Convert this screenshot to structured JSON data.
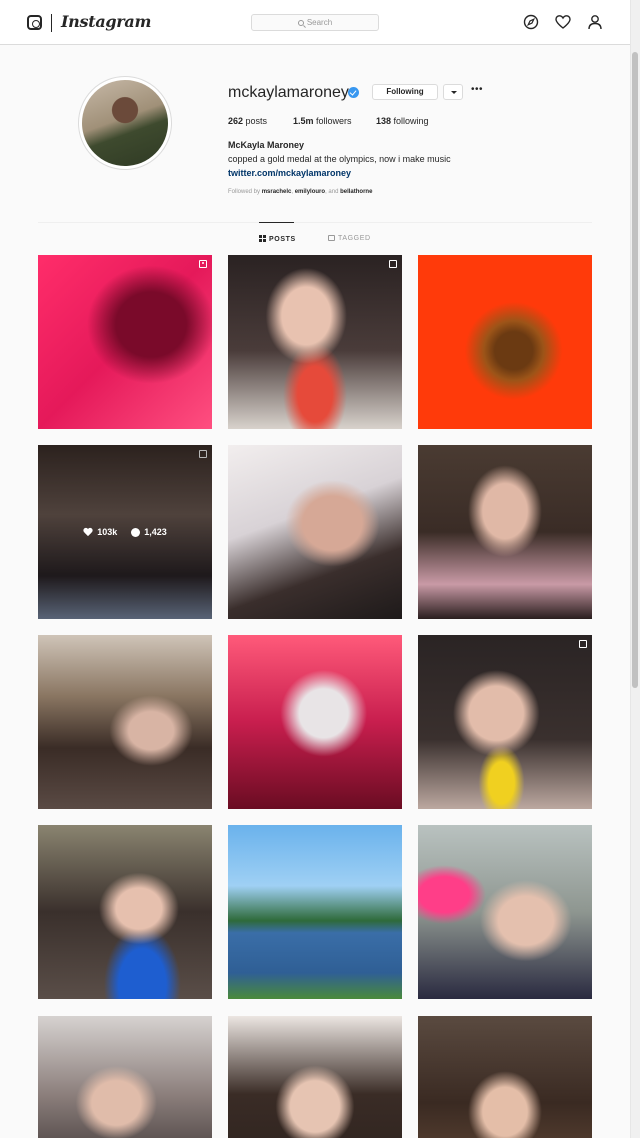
{
  "header": {
    "wordmark": "Instagram",
    "search_placeholder": "Search",
    "icons": [
      "instagram-camera-icon",
      "explore-compass-icon",
      "activity-heart-icon",
      "profile-person-icon"
    ]
  },
  "profile": {
    "username": "mckaylamaroney",
    "verified": true,
    "following_button": "Following",
    "more_label": "•••",
    "stats": {
      "posts_count": "262",
      "posts_label": "posts",
      "followers_count": "1.5m",
      "followers_label": "followers",
      "following_count": "138",
      "following_label": "following"
    },
    "full_name": "McKayla Maroney",
    "bio": "copped a gold medal at the olympics, now i make music",
    "link": "twitter.com/mckaylamaroney",
    "followed_by_prefix": "Followed by",
    "followed_by_1": "msrachelc",
    "followed_by_sep1": ",",
    "followed_by_2": "emilylouro",
    "followed_by_sep2": ", and",
    "followed_by_3": "bellathorne"
  },
  "tabs": {
    "posts": "POSTS",
    "tagged": "TAGGED"
  },
  "hover_post": {
    "likes": "103k",
    "comments": "1,423"
  },
  "colors": {
    "accent_blue": "#3897f0",
    "link_blue": "#003569",
    "border": "#dbdbdb"
  }
}
